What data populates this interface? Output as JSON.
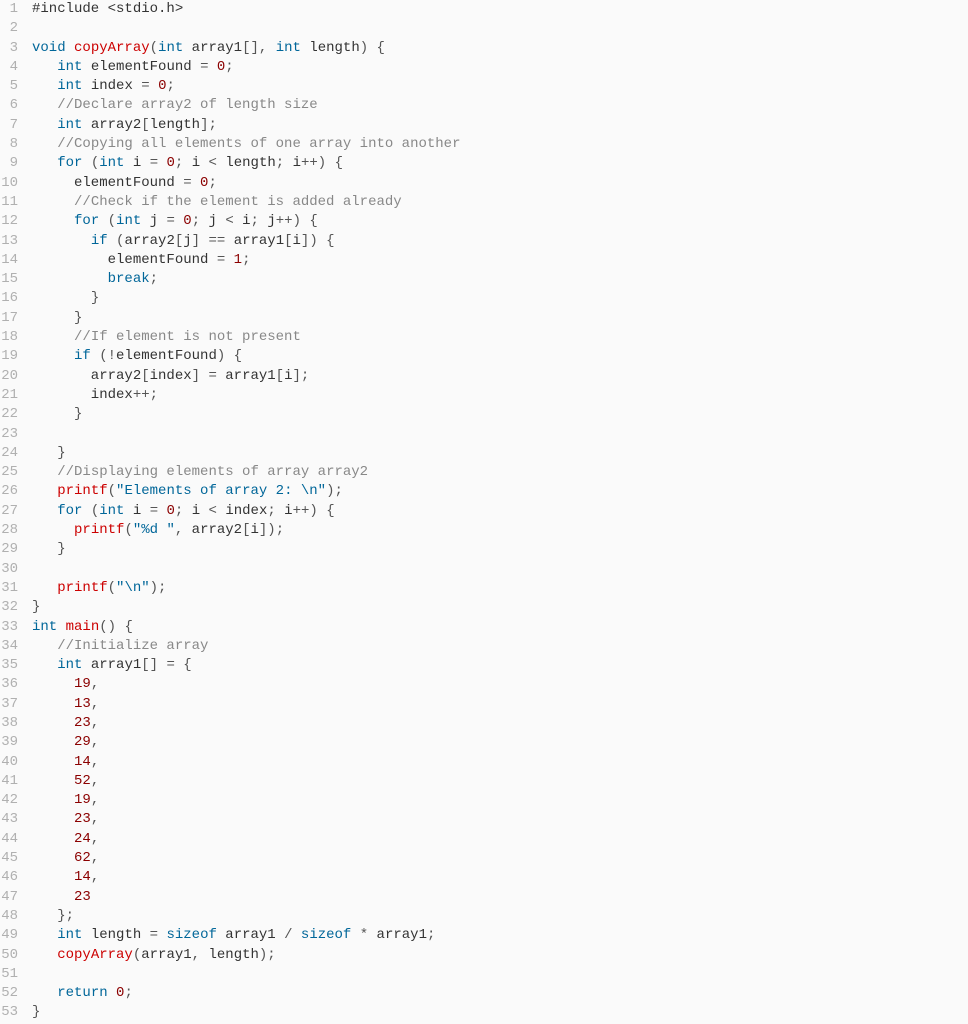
{
  "language": "c",
  "gutter": [
    "1",
    "2",
    "3",
    "4",
    "5",
    "6",
    "7",
    "8",
    "9",
    "10",
    "11",
    "12",
    "13",
    "14",
    "15",
    "16",
    "17",
    "18",
    "19",
    "20",
    "21",
    "22",
    "23",
    "24",
    "25",
    "26",
    "27",
    "28",
    "29",
    "30",
    "31",
    "32",
    "33",
    "34",
    "35",
    "36",
    "37",
    "38",
    "39",
    "40",
    "41",
    "42",
    "43",
    "44",
    "45",
    "46",
    "47",
    "48",
    "49",
    "50",
    "51",
    "52",
    "53"
  ],
  "lines": [
    [
      [
        "pp",
        "#include <stdio.h>"
      ]
    ],
    [],
    [
      [
        "kw",
        "void"
      ],
      [
        "id",
        " "
      ],
      [
        "fn",
        "copyArray"
      ],
      [
        "pn",
        "("
      ],
      [
        "kw",
        "int"
      ],
      [
        "id",
        " array1"
      ],
      [
        "pn",
        "[]"
      ],
      [
        "pn",
        ", "
      ],
      [
        "kw",
        "int"
      ],
      [
        "id",
        " length"
      ],
      [
        "pn",
        ") {"
      ]
    ],
    [
      [
        "id",
        "   "
      ],
      [
        "kw",
        "int"
      ],
      [
        "id",
        " elementFound "
      ],
      [
        "op",
        "="
      ],
      [
        "id",
        " "
      ],
      [
        "num",
        "0"
      ],
      [
        "pn",
        ";"
      ]
    ],
    [
      [
        "id",
        "   "
      ],
      [
        "kw",
        "int"
      ],
      [
        "id",
        " index "
      ],
      [
        "op",
        "="
      ],
      [
        "id",
        " "
      ],
      [
        "num",
        "0"
      ],
      [
        "pn",
        ";"
      ]
    ],
    [
      [
        "id",
        "   "
      ],
      [
        "cm",
        "//Declare array2 of length size"
      ]
    ],
    [
      [
        "id",
        "   "
      ],
      [
        "kw",
        "int"
      ],
      [
        "id",
        " array2"
      ],
      [
        "pn",
        "["
      ],
      [
        "id",
        "length"
      ],
      [
        "pn",
        "];"
      ]
    ],
    [
      [
        "id",
        "   "
      ],
      [
        "cm",
        "//Copying all elements of one array into another"
      ]
    ],
    [
      [
        "id",
        "   "
      ],
      [
        "kw",
        "for"
      ],
      [
        "id",
        " "
      ],
      [
        "pn",
        "("
      ],
      [
        "kw",
        "int"
      ],
      [
        "id",
        " i "
      ],
      [
        "op",
        "="
      ],
      [
        "id",
        " "
      ],
      [
        "num",
        "0"
      ],
      [
        "pn",
        "; "
      ],
      [
        "id",
        "i "
      ],
      [
        "op",
        "<"
      ],
      [
        "id",
        " length"
      ],
      [
        "pn",
        "; "
      ],
      [
        "id",
        "i"
      ],
      [
        "op",
        "++"
      ],
      [
        "pn",
        ") {"
      ]
    ],
    [
      [
        "id",
        "     elementFound "
      ],
      [
        "op",
        "="
      ],
      [
        "id",
        " "
      ],
      [
        "num",
        "0"
      ],
      [
        "pn",
        ";"
      ]
    ],
    [
      [
        "id",
        "     "
      ],
      [
        "cm",
        "//Check if the element is added already"
      ]
    ],
    [
      [
        "id",
        "     "
      ],
      [
        "kw",
        "for"
      ],
      [
        "id",
        " "
      ],
      [
        "pn",
        "("
      ],
      [
        "kw",
        "int"
      ],
      [
        "id",
        " j "
      ],
      [
        "op",
        "="
      ],
      [
        "id",
        " "
      ],
      [
        "num",
        "0"
      ],
      [
        "pn",
        "; "
      ],
      [
        "id",
        "j "
      ],
      [
        "op",
        "<"
      ],
      [
        "id",
        " i"
      ],
      [
        "pn",
        "; "
      ],
      [
        "id",
        "j"
      ],
      [
        "op",
        "++"
      ],
      [
        "pn",
        ") {"
      ]
    ],
    [
      [
        "id",
        "       "
      ],
      [
        "kw",
        "if"
      ],
      [
        "id",
        " "
      ],
      [
        "pn",
        "("
      ],
      [
        "id",
        "array2"
      ],
      [
        "pn",
        "["
      ],
      [
        "id",
        "j"
      ],
      [
        "pn",
        "] "
      ],
      [
        "op",
        "=="
      ],
      [
        "id",
        " array1"
      ],
      [
        "pn",
        "["
      ],
      [
        "id",
        "i"
      ],
      [
        "pn",
        "]) {"
      ]
    ],
    [
      [
        "id",
        "         elementFound "
      ],
      [
        "op",
        "="
      ],
      [
        "id",
        " "
      ],
      [
        "num",
        "1"
      ],
      [
        "pn",
        ";"
      ]
    ],
    [
      [
        "id",
        "         "
      ],
      [
        "kw",
        "break"
      ],
      [
        "pn",
        ";"
      ]
    ],
    [
      [
        "id",
        "       "
      ],
      [
        "pn",
        "}"
      ]
    ],
    [
      [
        "id",
        "     "
      ],
      [
        "pn",
        "}"
      ]
    ],
    [
      [
        "id",
        "     "
      ],
      [
        "cm",
        "//If element is not present"
      ]
    ],
    [
      [
        "id",
        "     "
      ],
      [
        "kw",
        "if"
      ],
      [
        "id",
        " "
      ],
      [
        "pn",
        "("
      ],
      [
        "op",
        "!"
      ],
      [
        "id",
        "elementFound"
      ],
      [
        "pn",
        ") {"
      ]
    ],
    [
      [
        "id",
        "       array2"
      ],
      [
        "pn",
        "["
      ],
      [
        "id",
        "index"
      ],
      [
        "pn",
        "] "
      ],
      [
        "op",
        "="
      ],
      [
        "id",
        " array1"
      ],
      [
        "pn",
        "["
      ],
      [
        "id",
        "i"
      ],
      [
        "pn",
        "];"
      ]
    ],
    [
      [
        "id",
        "       index"
      ],
      [
        "op",
        "++"
      ],
      [
        "pn",
        ";"
      ]
    ],
    [
      [
        "id",
        "     "
      ],
      [
        "pn",
        "}"
      ]
    ],
    [],
    [
      [
        "id",
        "   "
      ],
      [
        "pn",
        "}"
      ]
    ],
    [
      [
        "id",
        "   "
      ],
      [
        "cm",
        "//Displaying elements of array array2"
      ]
    ],
    [
      [
        "id",
        "   "
      ],
      [
        "fn",
        "printf"
      ],
      [
        "pn",
        "("
      ],
      [
        "str",
        "\"Elements of array 2: \\n\""
      ],
      [
        "pn",
        ");"
      ]
    ],
    [
      [
        "id",
        "   "
      ],
      [
        "kw",
        "for"
      ],
      [
        "id",
        " "
      ],
      [
        "pn",
        "("
      ],
      [
        "kw",
        "int"
      ],
      [
        "id",
        " i "
      ],
      [
        "op",
        "="
      ],
      [
        "id",
        " "
      ],
      [
        "num",
        "0"
      ],
      [
        "pn",
        "; "
      ],
      [
        "id",
        "i "
      ],
      [
        "op",
        "<"
      ],
      [
        "id",
        " index"
      ],
      [
        "pn",
        "; "
      ],
      [
        "id",
        "i"
      ],
      [
        "op",
        "++"
      ],
      [
        "pn",
        ") {"
      ]
    ],
    [
      [
        "id",
        "     "
      ],
      [
        "fn",
        "printf"
      ],
      [
        "pn",
        "("
      ],
      [
        "str",
        "\"%d \""
      ],
      [
        "pn",
        ", "
      ],
      [
        "id",
        "array2"
      ],
      [
        "pn",
        "["
      ],
      [
        "id",
        "i"
      ],
      [
        "pn",
        "]);"
      ]
    ],
    [
      [
        "id",
        "   "
      ],
      [
        "pn",
        "}"
      ]
    ],
    [],
    [
      [
        "id",
        "   "
      ],
      [
        "fn",
        "printf"
      ],
      [
        "pn",
        "("
      ],
      [
        "str",
        "\"\\n\""
      ],
      [
        "pn",
        ");"
      ]
    ],
    [
      [
        "pn",
        "}"
      ]
    ],
    [
      [
        "kw",
        "int"
      ],
      [
        "id",
        " "
      ],
      [
        "fn",
        "main"
      ],
      [
        "pn",
        "() {"
      ]
    ],
    [
      [
        "id",
        "   "
      ],
      [
        "cm",
        "//Initialize array"
      ]
    ],
    [
      [
        "id",
        "   "
      ],
      [
        "kw",
        "int"
      ],
      [
        "id",
        " array1"
      ],
      [
        "pn",
        "[] "
      ],
      [
        "op",
        "="
      ],
      [
        "id",
        " "
      ],
      [
        "pn",
        "{"
      ]
    ],
    [
      [
        "id",
        "     "
      ],
      [
        "num",
        "19"
      ],
      [
        "pn",
        ","
      ]
    ],
    [
      [
        "id",
        "     "
      ],
      [
        "num",
        "13"
      ],
      [
        "pn",
        ","
      ]
    ],
    [
      [
        "id",
        "     "
      ],
      [
        "num",
        "23"
      ],
      [
        "pn",
        ","
      ]
    ],
    [
      [
        "id",
        "     "
      ],
      [
        "num",
        "29"
      ],
      [
        "pn",
        ","
      ]
    ],
    [
      [
        "id",
        "     "
      ],
      [
        "num",
        "14"
      ],
      [
        "pn",
        ","
      ]
    ],
    [
      [
        "id",
        "     "
      ],
      [
        "num",
        "52"
      ],
      [
        "pn",
        ","
      ]
    ],
    [
      [
        "id",
        "     "
      ],
      [
        "num",
        "19"
      ],
      [
        "pn",
        ","
      ]
    ],
    [
      [
        "id",
        "     "
      ],
      [
        "num",
        "23"
      ],
      [
        "pn",
        ","
      ]
    ],
    [
      [
        "id",
        "     "
      ],
      [
        "num",
        "24"
      ],
      [
        "pn",
        ","
      ]
    ],
    [
      [
        "id",
        "     "
      ],
      [
        "num",
        "62"
      ],
      [
        "pn",
        ","
      ]
    ],
    [
      [
        "id",
        "     "
      ],
      [
        "num",
        "14"
      ],
      [
        "pn",
        ","
      ]
    ],
    [
      [
        "id",
        "     "
      ],
      [
        "num",
        "23"
      ]
    ],
    [
      [
        "id",
        "   "
      ],
      [
        "pn",
        "};"
      ]
    ],
    [
      [
        "id",
        "   "
      ],
      [
        "kw",
        "int"
      ],
      [
        "id",
        " length "
      ],
      [
        "op",
        "="
      ],
      [
        "id",
        " "
      ],
      [
        "kw",
        "sizeof"
      ],
      [
        "id",
        " array1 "
      ],
      [
        "op",
        "/"
      ],
      [
        "id",
        " "
      ],
      [
        "kw",
        "sizeof"
      ],
      [
        "id",
        " "
      ],
      [
        "op",
        "*"
      ],
      [
        "id",
        " array1"
      ],
      [
        "pn",
        ";"
      ]
    ],
    [
      [
        "id",
        "   "
      ],
      [
        "fn",
        "copyArray"
      ],
      [
        "pn",
        "("
      ],
      [
        "id",
        "array1"
      ],
      [
        "pn",
        ", "
      ],
      [
        "id",
        "length"
      ],
      [
        "pn",
        ");"
      ]
    ],
    [],
    [
      [
        "id",
        "   "
      ],
      [
        "kw",
        "return"
      ],
      [
        "id",
        " "
      ],
      [
        "num",
        "0"
      ],
      [
        "pn",
        ";"
      ]
    ],
    [
      [
        "pn",
        "}"
      ]
    ]
  ]
}
